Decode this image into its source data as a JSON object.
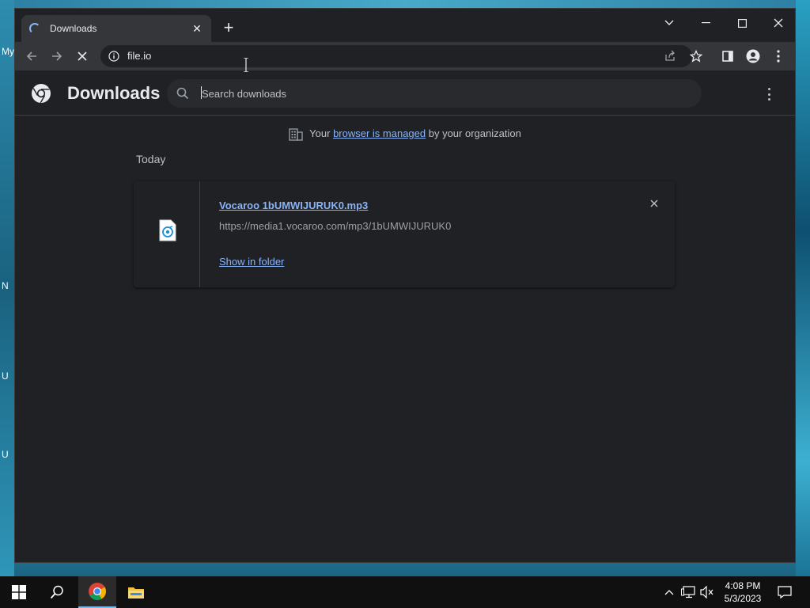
{
  "desktop": {
    "left_labels": [
      "My",
      "N",
      "U",
      "U"
    ]
  },
  "tab": {
    "title": "Downloads"
  },
  "toolbar": {
    "url": "file.io"
  },
  "downloads_page": {
    "title": "Downloads",
    "search_placeholder": "Search downloads",
    "managed_prefix": "Your ",
    "managed_link": "browser is managed",
    "managed_suffix": " by your organization",
    "section_today": "Today",
    "item": {
      "file_name": "Vocaroo 1bUMWIJURUK0.mp3",
      "url": "https://media1.vocaroo.com/mp3/1bUMWIJURUK0",
      "action": "Show in folder"
    }
  },
  "taskbar": {
    "time": "4:08 PM",
    "date": "5/3/2023"
  },
  "colors": {
    "accent": "#8ab4f8",
    "page_bg": "#202124",
    "toolbar_bg": "#35363a"
  }
}
